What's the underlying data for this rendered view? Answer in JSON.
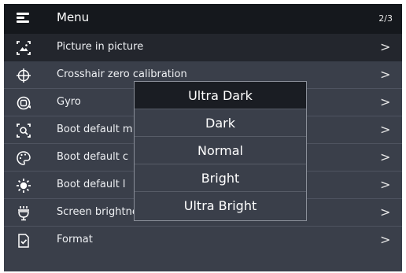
{
  "header": {
    "title": "Menu",
    "page_indicator": "2/3",
    "menu_icon": "hamburger-icon"
  },
  "menu": {
    "items": [
      {
        "label": "Picture in picture",
        "icon": "picture-in-picture-icon",
        "selected": true
      },
      {
        "label": "Crosshair zero calibration",
        "icon": "crosshair-icon"
      },
      {
        "label": "Gyro",
        "icon": "gyro-icon"
      },
      {
        "label": "Boot default m",
        "icon": "zoom-scan-icon"
      },
      {
        "label": "Boot default c",
        "icon": "palette-icon"
      },
      {
        "label": "Boot default l",
        "icon": "light-icon"
      },
      {
        "label": "Screen brightness",
        "icon": "brightness-icon"
      },
      {
        "label": "Format",
        "icon": "format-icon"
      }
    ],
    "chevron": ">"
  },
  "brightness_popup": {
    "options": [
      "Ultra Dark",
      "Dark",
      "Normal",
      "Bright",
      "Ultra Bright"
    ],
    "selected": "Ultra Dark"
  },
  "colors": {
    "screen_bg": "#3a3f4a",
    "header_bg": "#15181d",
    "selected_bg": "#23262d",
    "text": "#eef0f3"
  }
}
